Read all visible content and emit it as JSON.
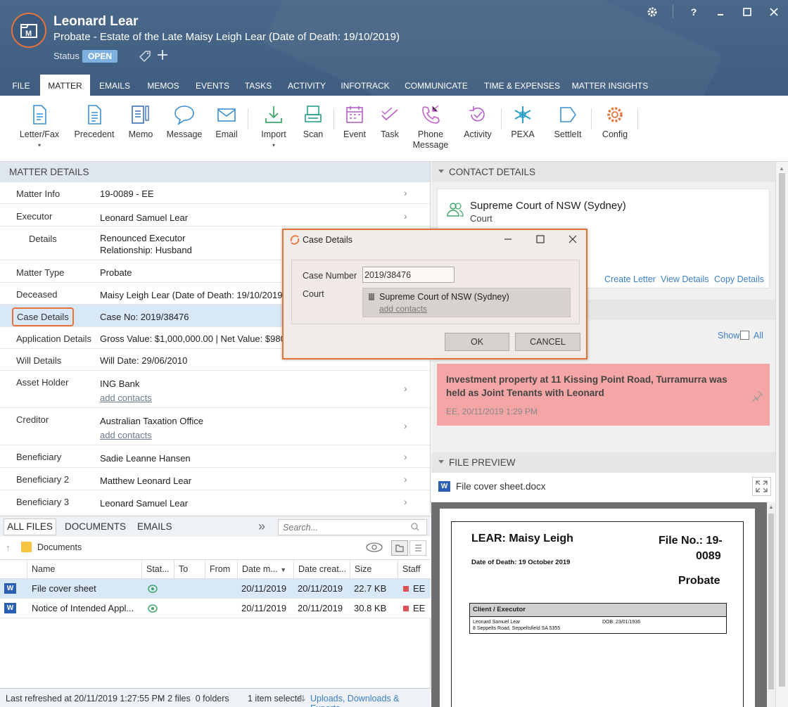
{
  "header": {
    "client_name": "Leonard Lear",
    "matter_description": "Probate - Estate of the Late Maisy Leigh Lear (Date of Death: 19/10/2019)",
    "status_label": "Status",
    "status_value": "OPEN",
    "window_buttons": [
      "?"
    ]
  },
  "tabs": [
    "FILE",
    "MATTER",
    "EMAILS",
    "MEMOS",
    "EVENTS",
    "TASKS",
    "ACTIVITY",
    "INFOTRACK",
    "COMMUNICATE",
    "TIME & EXPENSES",
    "MATTER INSIGHTS"
  ],
  "active_tab": "MATTER",
  "ribbon": [
    {
      "label": "Letter/Fax",
      "icon": "letter-icon"
    },
    {
      "label": "Precedent",
      "icon": "precedent-icon"
    },
    {
      "label": "Memo",
      "icon": "memo-icon"
    },
    {
      "label": "Message",
      "icon": "message-icon"
    },
    {
      "label": "Email",
      "icon": "email-icon"
    },
    {
      "label": "Import",
      "icon": "import-icon"
    },
    {
      "label": "Scan",
      "icon": "scan-icon"
    },
    {
      "label": "Event",
      "icon": "event-icon"
    },
    {
      "label": "Task",
      "icon": "task-icon"
    },
    {
      "label": "Phone Message",
      "icon": "phone-icon"
    },
    {
      "label": "Activity",
      "icon": "activity-icon"
    },
    {
      "label": "PEXA",
      "icon": "pexa-icon"
    },
    {
      "label": "SettleIt",
      "icon": "settleit-icon"
    },
    {
      "label": "Config",
      "icon": "gear-icon"
    }
  ],
  "matter_details": {
    "heading": "MATTER DETAILS",
    "rows": [
      {
        "label": "Matter Info",
        "value": "19-0089 - EE"
      },
      {
        "label": "Executor",
        "value": "Leonard Samuel Lear"
      },
      {
        "label": "Details",
        "value": "Renounced Executor",
        "value2": "Relationship: Husband"
      },
      {
        "label": "Matter Type",
        "value": "Probate"
      },
      {
        "label": "Deceased",
        "value": "Maisy Leigh Lear (Date of Death: 19/10/2019)"
      },
      {
        "label": "Case Details",
        "value": "Case No: 2019/38476"
      },
      {
        "label": "Application Details",
        "value": "Gross Value: $1,000,000.00 | Net Value: $980,0"
      },
      {
        "label": "Will Details",
        "value": "Will Date: 29/06/2010"
      },
      {
        "label": "Asset Holder",
        "value": "ING Bank",
        "link": "add contacts"
      },
      {
        "label": "Creditor",
        "value": "Australian Taxation Office",
        "link": "add contacts"
      },
      {
        "label": "Beneficiary",
        "value": "Sadie Leanne Hansen"
      },
      {
        "label": "Beneficiary 2",
        "value": "Matthew Leonard Lear"
      },
      {
        "label": "Beneficiary 3",
        "value": "Leonard Samuel Lear"
      }
    ]
  },
  "contact_details": {
    "heading": "CONTACT DETAILS",
    "name": "Supreme Court of NSW (Sydney)",
    "type": "Court",
    "actions": [
      "Create Letter",
      "View Details",
      "Copy Details"
    ]
  },
  "notes": {
    "show_label": "Show",
    "all_label": "All",
    "note_text": "Investment property at 11 Kissing Point Road, Turramurra was held as Joint Tenants with Leonard",
    "note_meta": "EE, 20/11/2019 1:29 PM",
    "note_color": "#f4a6a6"
  },
  "file_preview": {
    "heading": "FILE PREVIEW",
    "file_name": "File cover sheet.docx",
    "doc": {
      "title": "LEAR: Maisy Leigh",
      "dod": "Date of Death: 19 October 2019",
      "file_no_1": "File No.: 19-",
      "file_no_2": "0089",
      "type": "Probate",
      "table_header": "Client / Executor",
      "client_name": "Leonard Samuel Lear",
      "client_address": "8 Seppelts Road, Seppeltsfield SA 5355",
      "client_dob": "DOB: 23/01/1936"
    }
  },
  "files": {
    "tabs": [
      "ALL FILES",
      "DOCUMENTS",
      "EMAILS"
    ],
    "search_placeholder": "Search...",
    "folder": "Documents",
    "columns": [
      "Name",
      "Stat...",
      "To",
      "From",
      "Date m...",
      "Date creat...",
      "Size",
      "Staff"
    ],
    "rows": [
      {
        "name": "File cover sheet",
        "date_modified": "20/11/2019",
        "date_created": "20/11/2019",
        "size": "22.7 KB",
        "staff": "EE"
      },
      {
        "name": "Notice of Intended Appl...",
        "date_modified": "20/11/2019",
        "date_created": "20/11/2019",
        "size": "30.8 KB",
        "staff": "EE"
      }
    ]
  },
  "statusbar": {
    "refreshed": "Last refreshed at 20/11/2019 1:27:55 PM",
    "counts": "-  2 files  0 folders",
    "selection": "1 item selecte",
    "uploads": "Uploads, Downloads & Exports"
  },
  "dialog": {
    "title": "Case Details",
    "case_number_label": "Case Number",
    "case_number_value": "2019/38476",
    "court_label": "Court",
    "court_value": "Supreme Court of NSW (Sydney)",
    "court_link": "add contacts",
    "ok": "OK",
    "cancel": "CANCEL"
  },
  "colors": {
    "header_bg": "#44628a",
    "accent": "#e8733a",
    "status_badge": "#7eb0e0",
    "link": "#3b7fc4"
  }
}
